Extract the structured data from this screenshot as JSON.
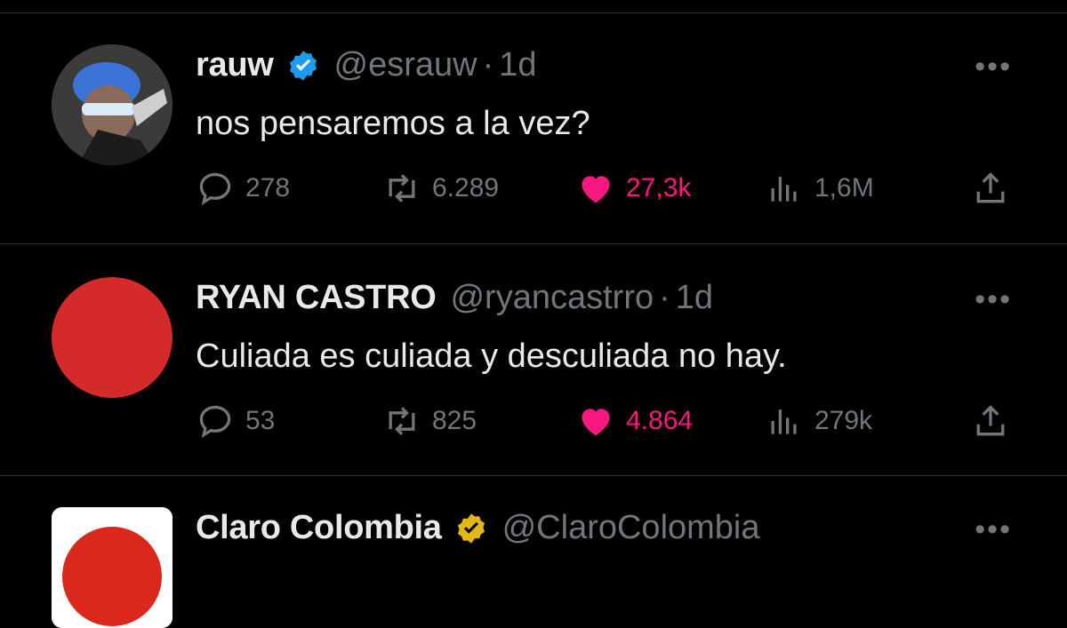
{
  "tweets": [
    {
      "name": "rauw",
      "verified": "blue",
      "handle": "@esrauw",
      "separator": "·",
      "time": "1d",
      "text": "nos pensaremos a la vez?",
      "replies": "278",
      "retweets": "6.289",
      "likes": "27,3k",
      "views": "1,6M",
      "more": "•••"
    },
    {
      "name": "RYAN CASTRO",
      "handle": "@ryancastrro",
      "separator": "·",
      "time": "1d",
      "text": "Culiada es culiada y desculiada no hay.",
      "replies": "53",
      "retweets": "825",
      "likes": "4.864",
      "views": "279k",
      "more": "•••"
    },
    {
      "name": "Claro Colombia",
      "verified": "gold",
      "handle": "@ClaroColombia",
      "more": "•••"
    }
  ],
  "colors": {
    "background": "#000000",
    "divider": "#2f3336",
    "primary_text": "#e7e9ea",
    "secondary_text": "#71767b",
    "like": "#f91880",
    "verified_blue": "#1d9bf0",
    "verified_gold": "#e2b719",
    "avatar_red": "#d52a2a"
  },
  "icons": [
    "reply-icon",
    "retweet-icon",
    "like-icon",
    "views-icon",
    "share-icon",
    "verified-icon",
    "more-icon"
  ]
}
